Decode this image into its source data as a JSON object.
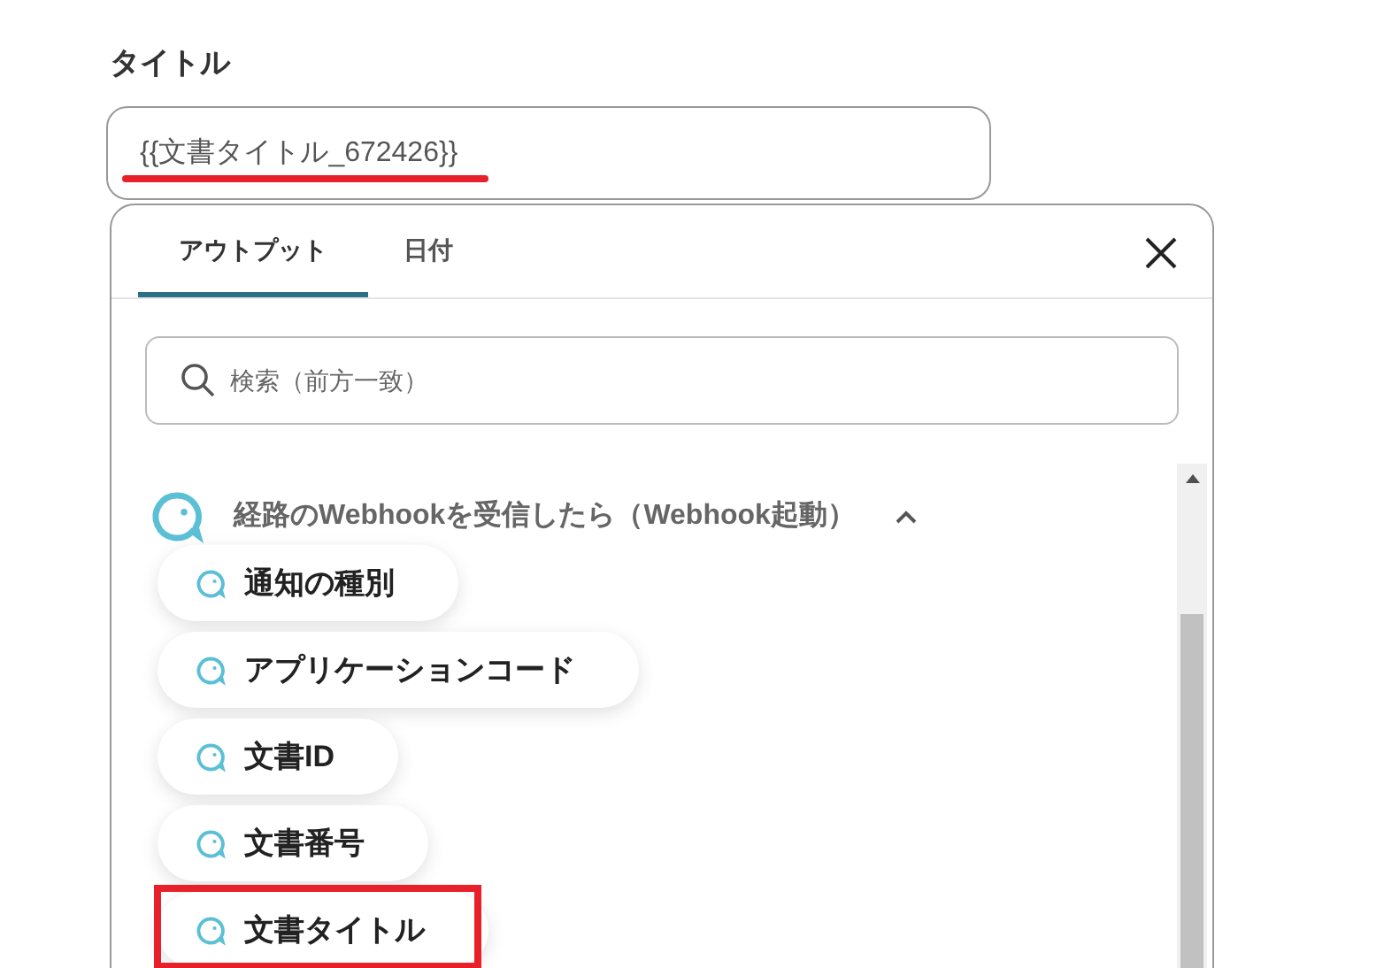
{
  "field": {
    "label": "タイトル",
    "value": "{{文書タイトル_672426}}",
    "underlined": true
  },
  "panel": {
    "tabs": [
      {
        "label": "アウトプット",
        "selected": true
      },
      {
        "label": "日付",
        "selected": false
      }
    ],
    "search": {
      "placeholder": "検索（前方一致）"
    },
    "group": {
      "title": "経路のWebhookを受信したら（Webhook起動）",
      "expanded": true,
      "items": [
        {
          "label": "通知の種別",
          "highlighted": false
        },
        {
          "label": "アプリケーションコード",
          "highlighted": false
        },
        {
          "label": "文書ID",
          "highlighted": false
        },
        {
          "label": "文書番号",
          "highlighted": false
        },
        {
          "label": "文書タイトル",
          "highlighted": true
        }
      ]
    }
  }
}
